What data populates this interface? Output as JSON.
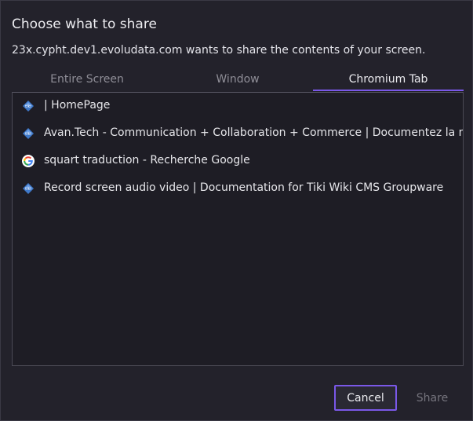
{
  "dialog": {
    "title": "Choose what to share",
    "subtitle": "23x.cypht.dev1.evoludata.com wants to share the contents of your screen."
  },
  "tabs": [
    {
      "label": "Entire Screen",
      "active": false
    },
    {
      "label": "Window",
      "active": false
    },
    {
      "label": "Chromium Tab",
      "active": true
    }
  ],
  "tab_items": [
    {
      "label": "| HomePage",
      "icon": "tiki-icon"
    },
    {
      "label": "Avan.Tech - Communication + Collaboration + Commerce | Documentez la nouv",
      "icon": "tiki-icon"
    },
    {
      "label": "squart traduction - Recherche Google",
      "icon": "google-icon"
    },
    {
      "label": "Record screen audio video | Documentation for Tiki Wiki CMS Groupware",
      "icon": "tiki-icon"
    }
  ],
  "buttons": {
    "cancel": "Cancel",
    "share": "Share"
  },
  "colors": {
    "accent": "#7a58e8",
    "background": "#23222b",
    "list_background": "#1e1d25"
  }
}
